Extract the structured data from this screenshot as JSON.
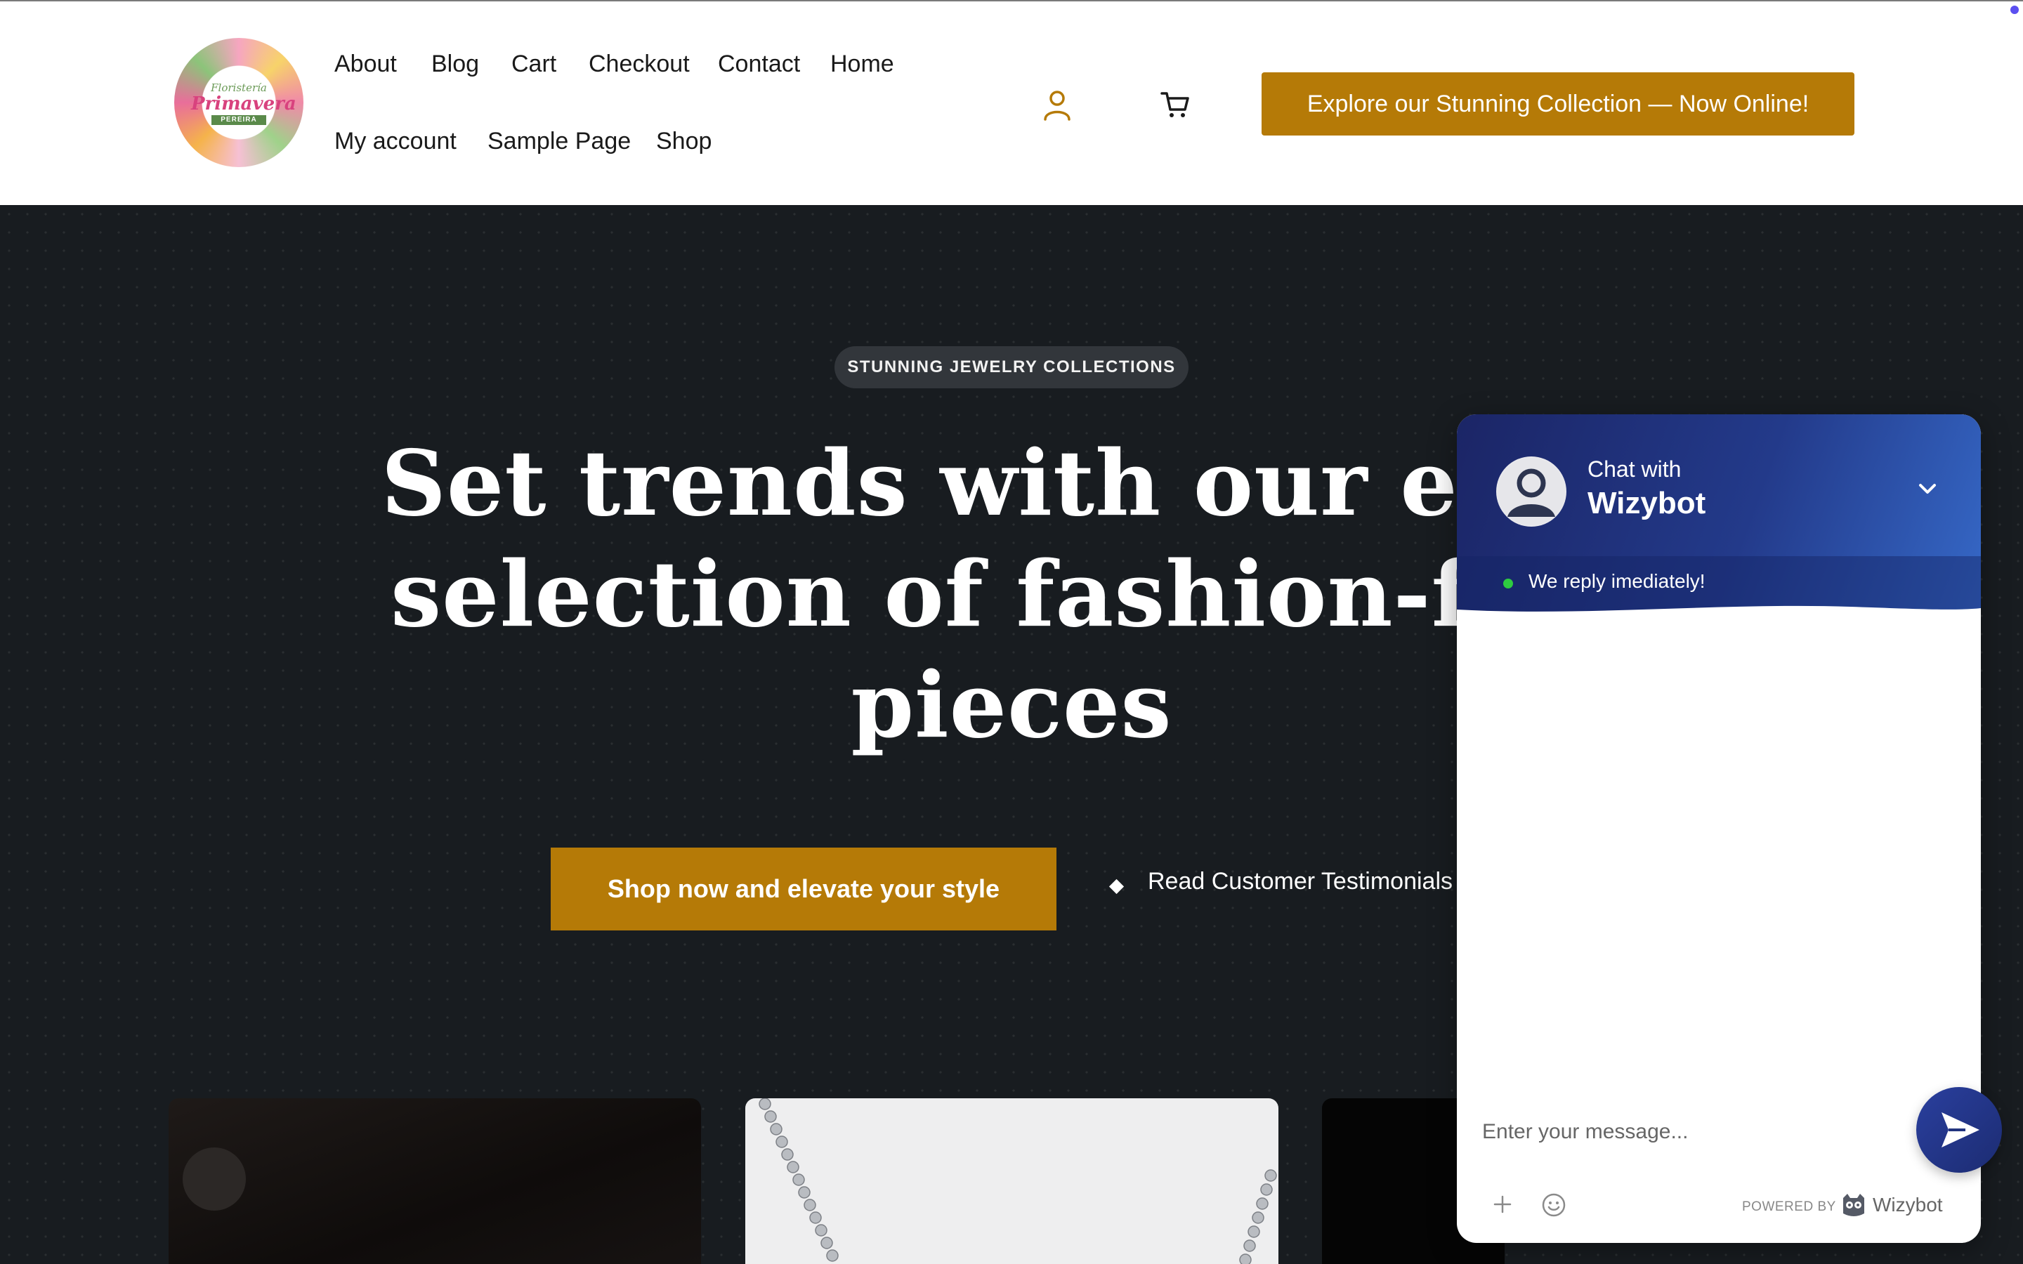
{
  "header": {
    "logo": {
      "line1": "Floristería",
      "line2": "Primavera",
      "line3": "PEREIRA"
    },
    "nav": [
      {
        "label": "About"
      },
      {
        "label": "Blog"
      },
      {
        "label": "Cart"
      },
      {
        "label": "Checkout"
      },
      {
        "label": "Contact"
      },
      {
        "label": "Home"
      },
      {
        "label": "My account"
      },
      {
        "label": "Sample Page"
      },
      {
        "label": "Shop"
      }
    ],
    "icons": {
      "account": "user-icon",
      "cart": "cart-icon"
    },
    "cta_label": "Explore our Stunning Collection — Now Online!"
  },
  "hero": {
    "badge": "STUNNING JEWELRY COLLECTIONS",
    "headline": {
      "line1": "Set trends with our exqu",
      "line2": "selection of fashion-forv",
      "line3": "pieces"
    },
    "primary_button": "Shop now and elevate your style",
    "secondary_link": "Read Customer Testimonials"
  },
  "chat": {
    "title_small": "Chat with",
    "title_big": "Wizybot",
    "status": "We reply imediately!",
    "input_placeholder": "Enter your message...",
    "powered_by": "POWERED BY",
    "brand": "Wizybot"
  },
  "colors": {
    "accent": "#b57a07",
    "hero_bg": "#181c20",
    "chat_header_start": "#1b2566",
    "chat_header_end": "#3669c8",
    "status_online": "#2ecc40"
  }
}
